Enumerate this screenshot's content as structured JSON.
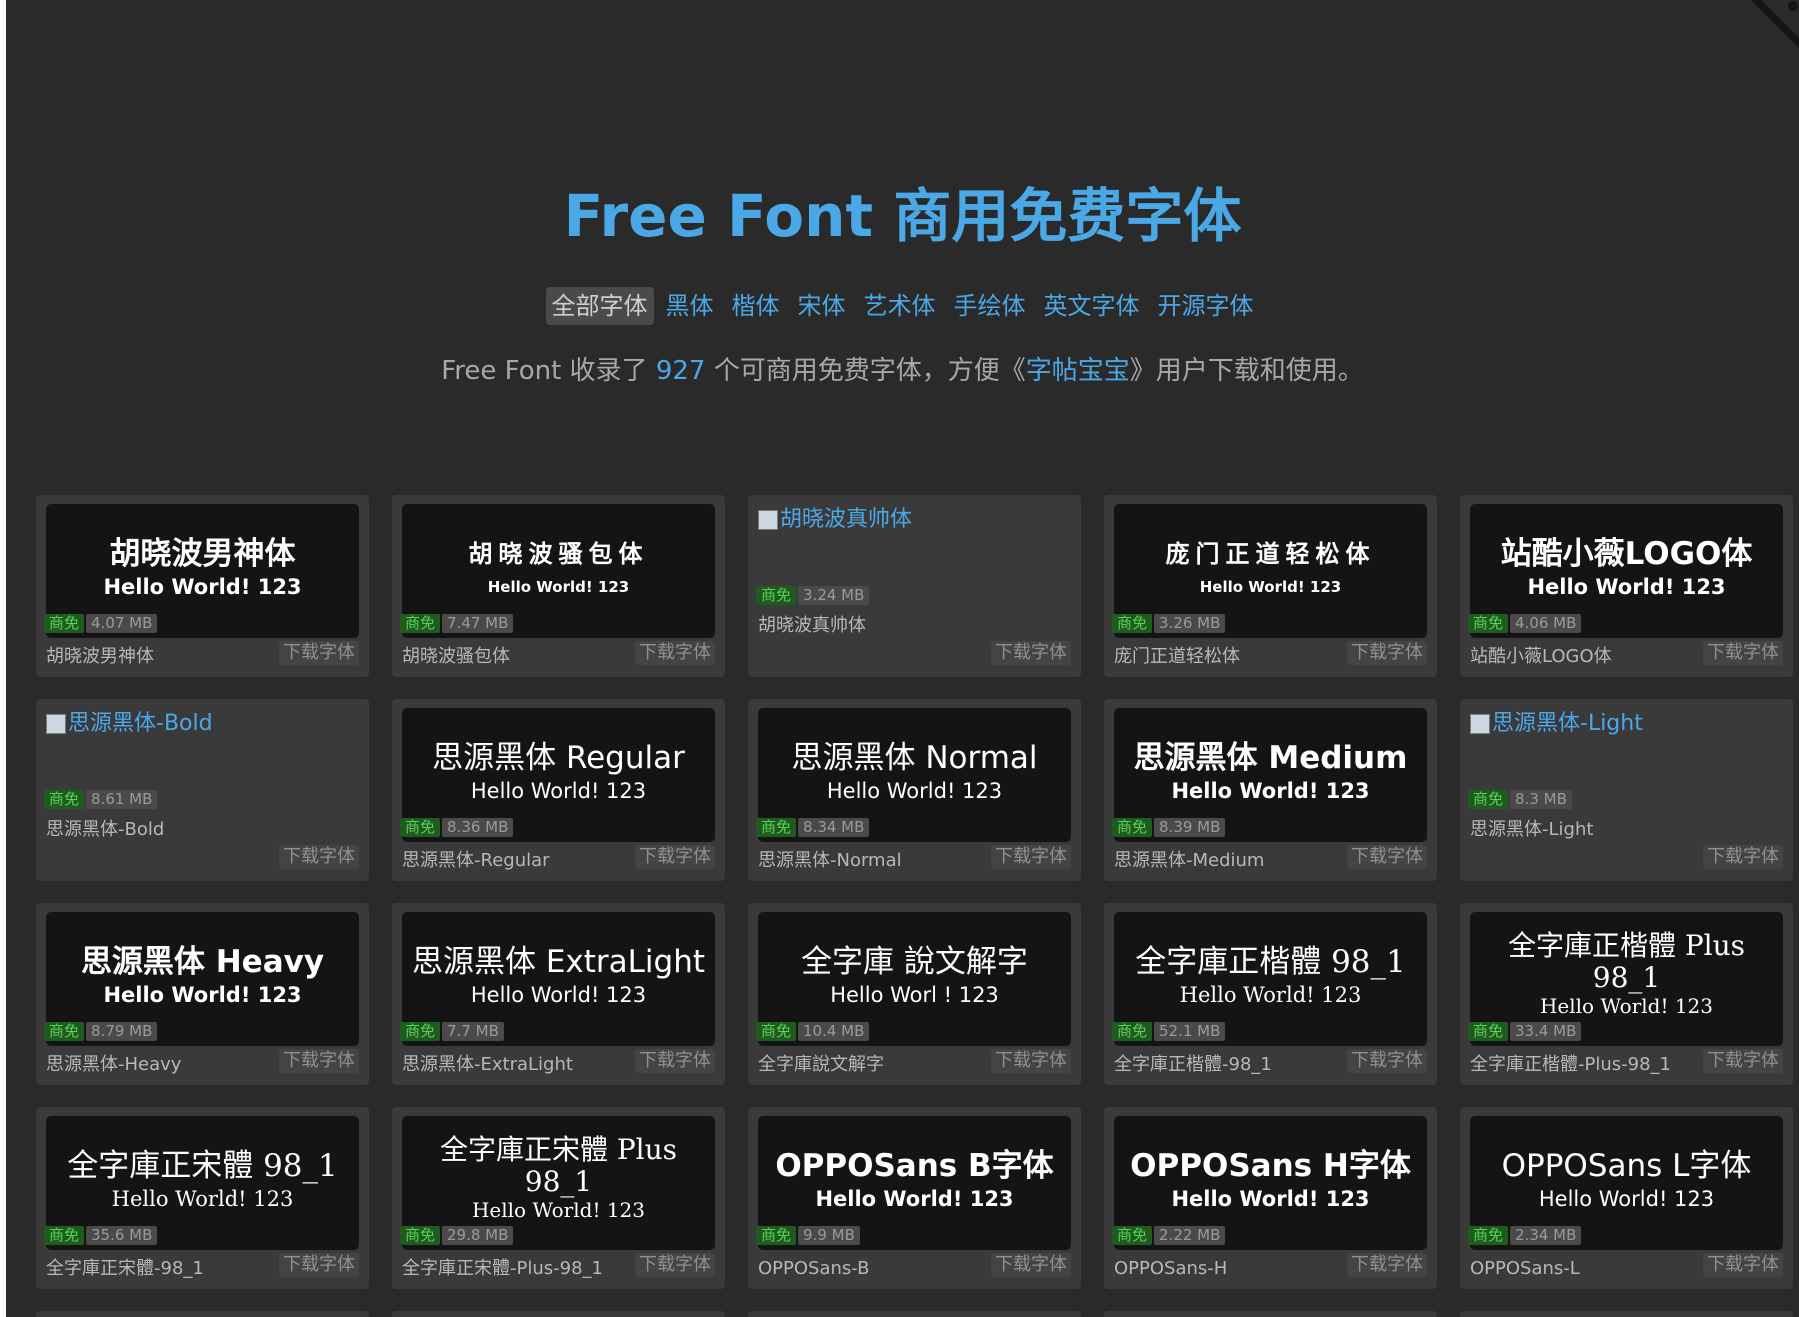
{
  "header": {
    "title": "Free Font 商用免费字体"
  },
  "nav": {
    "tabs": [
      {
        "label": "全部字体",
        "active": true
      },
      {
        "label": "黑体",
        "active": false
      },
      {
        "label": "楷体",
        "active": false
      },
      {
        "label": "宋体",
        "active": false
      },
      {
        "label": "艺术体",
        "active": false
      },
      {
        "label": "手绘体",
        "active": false
      },
      {
        "label": "英文字体",
        "active": false
      },
      {
        "label": "开源字体",
        "active": false
      }
    ]
  },
  "intro": {
    "part1": "Free Font 收录了 ",
    "count": "927",
    "part2": " 个可商用免费字体，方便《",
    "link": "字帖宝宝",
    "part3": "》用户下载和使用。"
  },
  "labels": {
    "badge": "商免",
    "download": "下载字体"
  },
  "fonts": [
    {
      "name": "胡晓波男神体",
      "preview": "胡晓波男神体",
      "hello": "Hello World! 123",
      "size": "4.07 MB",
      "style": "bold"
    },
    {
      "name": "胡晓波骚包体",
      "preview": "胡晓波骚包体",
      "hello": "Hello World! 123",
      "size": "7.47 MB",
      "style": "wide"
    },
    {
      "name": "胡晓波真帅体",
      "alt": "胡晓波真帅体",
      "size": "3.24 MB",
      "style": "broken"
    },
    {
      "name": "庞门正道轻松体",
      "preview": "庞门正道轻松体",
      "hello": "Hello World! 123",
      "size": "3.26 MB",
      "style": "wide"
    },
    {
      "name": "站酷小薇LOGO体",
      "preview": "站酷小薇LOGO体",
      "hello": "Hello World! 123",
      "size": "4.06 MB",
      "style": "bold"
    },
    {
      "name": "思源黑体-Bold",
      "alt": "思源黑体-Bold",
      "size": "8.61 MB",
      "style": "broken"
    },
    {
      "name": "思源黑体-Regular",
      "preview": "思源黑体 Regular",
      "hello": "Hello World! 123",
      "size": "8.36 MB",
      "style": "light"
    },
    {
      "name": "思源黑体-Normal",
      "preview": "思源黑体 Normal",
      "hello": "Hello World! 123",
      "size": "8.34 MB",
      "style": "light"
    },
    {
      "name": "思源黑体-Medium",
      "preview": "思源黑体 Medium",
      "hello": "Hello World! 123",
      "size": "8.39 MB",
      "style": "bold"
    },
    {
      "name": "思源黑体-Light",
      "alt": "思源黑体-Light",
      "size": "8.3 MB",
      "style": "broken"
    },
    {
      "name": "思源黑体-Heavy",
      "preview": "思源黑体 Heavy",
      "hello": "Hello World! 123",
      "size": "8.79 MB",
      "style": "bold"
    },
    {
      "name": "思源黑体-ExtraLight",
      "preview": "思源黑体 ExtraLight",
      "hello": "Hello World! 123",
      "size": "7.7 MB",
      "style": "light"
    },
    {
      "name": "全字庫說文解字",
      "preview": "全字庫 說文解字",
      "hello": "Hello Worl  ! 123",
      "size": "10.4 MB",
      "style": "light"
    },
    {
      "name": "全字庫正楷體-98_1",
      "preview": "全字庫正楷體 98_1",
      "hello": "Hello World! 123",
      "size": "52.1 MB",
      "style": "serif"
    },
    {
      "name": "全字庫正楷體-Plus-98_1",
      "preview": "全字庫正楷體 Plus 98_1",
      "hello": "Hello World! 123",
      "size": "33.4 MB",
      "style": "serif twoline"
    },
    {
      "name": "全字庫正宋體-98_1",
      "preview": "全字庫正宋體 98_1",
      "hello": "Hello World! 123",
      "size": "35.6 MB",
      "style": "serif"
    },
    {
      "name": "全字庫正宋體-Plus-98_1",
      "preview": "全字庫正宋體 Plus 98_1",
      "hello": "Hello World! 123",
      "size": "29.8 MB",
      "style": "serif twoline"
    },
    {
      "name": "OPPOSans-B",
      "preview": "OPPOSans B字体",
      "hello": "Hello World! 123",
      "size": "9.9 MB",
      "style": "bold"
    },
    {
      "name": "OPPOSans-H",
      "preview": "OPPOSans H字体",
      "hello": "Hello World! 123",
      "size": "2.22 MB",
      "style": "bold"
    },
    {
      "name": "OPPOSans-L",
      "preview": "OPPOSans L字体",
      "hello": "Hello World! 123",
      "size": "2.34 MB",
      "style": "light"
    }
  ]
}
